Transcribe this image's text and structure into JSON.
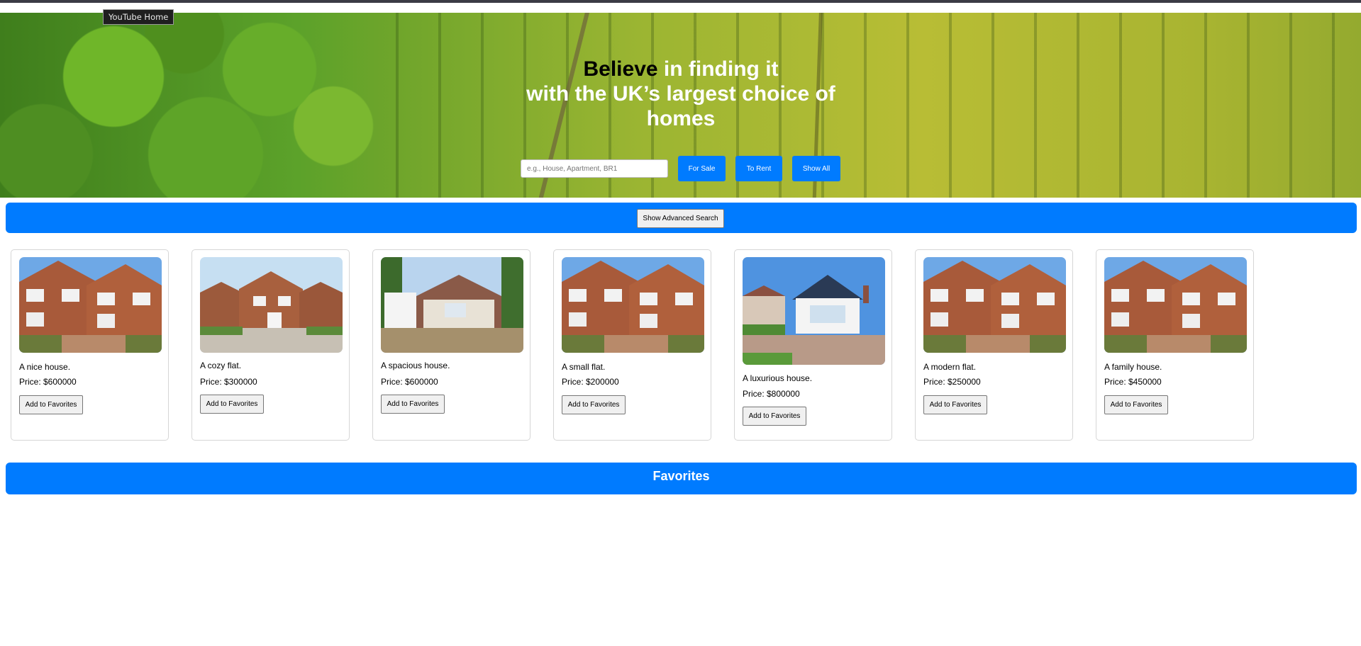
{
  "tooltip": {
    "label": "YouTube Home"
  },
  "hero": {
    "headline_dark": "Believe",
    "headline_light_1": " in finding it",
    "headline_light_2": "with the UK’s largest choice of homes",
    "search_placeholder": "e.g., House, Apartment, BR1",
    "search_value": "",
    "buttons": {
      "for_sale": "For Sale",
      "to_rent": "To Rent",
      "show_all": "Show All"
    }
  },
  "advanced": {
    "label": "Show Advanced Search"
  },
  "listings": [
    {
      "description": "A nice house.",
      "price": "Price: $600000",
      "button": "Add to Favorites",
      "image": "red-brick-semi-detached"
    },
    {
      "description": "A cozy flat.",
      "price": "Price: $300000",
      "button": "Add to Favorites",
      "image": "street-of-brick-houses"
    },
    {
      "description": "A spacious house.",
      "price": "Price: $600000",
      "button": "Add to Favorites",
      "image": "bungalow-with-garage"
    },
    {
      "description": "A small flat.",
      "price": "Price: $200000",
      "button": "Add to Favorites",
      "image": "red-brick-semi-detached"
    },
    {
      "description": "A luxurious house.",
      "price": "Price: $800000",
      "button": "Add to Favorites",
      "image": "white-bungalow-tudor-gable"
    },
    {
      "description": "A modern flat.",
      "price": "Price: $250000",
      "button": "Add to Favorites",
      "image": "red-brick-semi-detached"
    },
    {
      "description": "A family house.",
      "price": "Price: $450000",
      "button": "Add to Favorites",
      "image": "red-brick-semi-detached"
    }
  ],
  "favorites": {
    "title": "Favorites"
  },
  "colors": {
    "accent": "#007bff",
    "text": "#000000",
    "hero_text": "#ffffff"
  }
}
